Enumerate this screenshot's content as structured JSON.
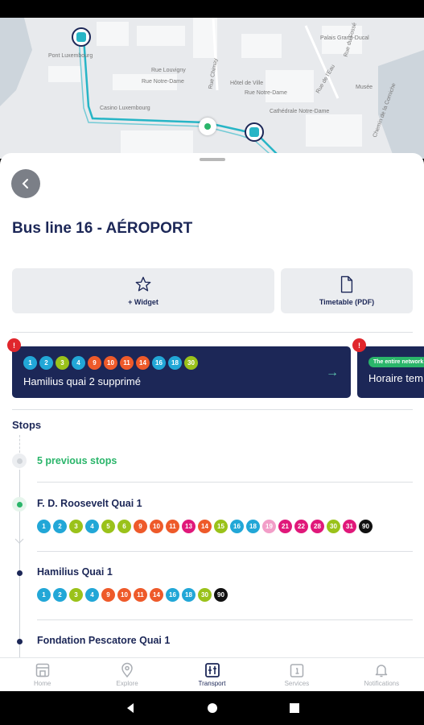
{
  "map": {
    "streets": [
      "Pont Luxembourg",
      "Rue Louvigny",
      "Rue Notre-Dame",
      "Casino Luxembourg",
      "Rue Chimay",
      "Hôtel de Ville",
      "Rue Notre-Dame",
      "Cathédrale Notre-Dame",
      "Palais Grand-Ducal",
      "Rue de l'Eau",
      "Musée",
      "Chemin de la Corniche",
      "Rue du Fossé"
    ]
  },
  "header": {
    "title": "Bus line 16 - AÉROPORT"
  },
  "actions": {
    "widget_label": "+ Widget",
    "timetable_label": "Timetable (PDF)"
  },
  "alerts": [
    {
      "badges": [
        {
          "n": "1",
          "c": "#22a7d7"
        },
        {
          "n": "2",
          "c": "#22a7d7"
        },
        {
          "n": "3",
          "c": "#9ac21a"
        },
        {
          "n": "4",
          "c": "#22a7d7"
        },
        {
          "n": "9",
          "c": "#ee5a2a"
        },
        {
          "n": "10",
          "c": "#ee5a2a"
        },
        {
          "n": "11",
          "c": "#ee5a2a"
        },
        {
          "n": "14",
          "c": "#ee5a2a"
        },
        {
          "n": "16",
          "c": "#22a7d7"
        },
        {
          "n": "18",
          "c": "#22a7d7"
        },
        {
          "n": "30",
          "c": "#9ac21a"
        }
      ],
      "text": "Hamilius quai 2 supprimé"
    },
    {
      "tag": "The entire network",
      "text": "Horaire tem"
    }
  ],
  "stops_title": "Stops",
  "previous_stops": "5 previous stops",
  "stops": [
    {
      "name": "F. D. Roosevelt Quai 1",
      "lines": [
        {
          "n": "1",
          "c": "#22a7d7"
        },
        {
          "n": "2",
          "c": "#22a7d7"
        },
        {
          "n": "3",
          "c": "#9ac21a"
        },
        {
          "n": "4",
          "c": "#22a7d7"
        },
        {
          "n": "5",
          "c": "#9ac21a"
        },
        {
          "n": "6",
          "c": "#9ac21a"
        },
        {
          "n": "9",
          "c": "#ee5a2a"
        },
        {
          "n": "10",
          "c": "#ee5a2a"
        },
        {
          "n": "11",
          "c": "#ee5a2a"
        },
        {
          "n": "13",
          "c": "#e0187a"
        },
        {
          "n": "14",
          "c": "#ee5a2a"
        },
        {
          "n": "15",
          "c": "#9ac21a"
        },
        {
          "n": "16",
          "c": "#22a7d7"
        },
        {
          "n": "18",
          "c": "#22a7d7"
        },
        {
          "n": "19",
          "c": "#f29ec8"
        },
        {
          "n": "21",
          "c": "#e0187a"
        },
        {
          "n": "22",
          "c": "#e0187a"
        },
        {
          "n": "28",
          "c": "#e0187a"
        },
        {
          "n": "30",
          "c": "#9ac21a"
        },
        {
          "n": "31",
          "c": "#e0187a"
        },
        {
          "n": "90",
          "c": "#111111"
        }
      ]
    },
    {
      "name": "Hamilius Quai 1",
      "lines": [
        {
          "n": "1",
          "c": "#22a7d7"
        },
        {
          "n": "2",
          "c": "#22a7d7"
        },
        {
          "n": "3",
          "c": "#9ac21a"
        },
        {
          "n": "4",
          "c": "#22a7d7"
        },
        {
          "n": "9",
          "c": "#ee5a2a"
        },
        {
          "n": "10",
          "c": "#ee5a2a"
        },
        {
          "n": "11",
          "c": "#ee5a2a"
        },
        {
          "n": "14",
          "c": "#ee5a2a"
        },
        {
          "n": "16",
          "c": "#22a7d7"
        },
        {
          "n": "18",
          "c": "#22a7d7"
        },
        {
          "n": "30",
          "c": "#9ac21a"
        },
        {
          "n": "90",
          "c": "#111111"
        }
      ]
    },
    {
      "name": "Fondation Pescatore Quai 1",
      "lines": []
    }
  ],
  "nav": {
    "items": [
      {
        "label": "Home",
        "icon": "home-icon"
      },
      {
        "label": "Explore",
        "icon": "map-pin-icon"
      },
      {
        "label": "Transport",
        "icon": "transport-icon"
      },
      {
        "label": "Services",
        "icon": "services-icon"
      },
      {
        "label": "Notifications",
        "icon": "bell-icon"
      }
    ],
    "active": "Transport"
  },
  "colors": {
    "navy": "#1c2757",
    "green": "#2ab56a",
    "alert_red": "#e0262c",
    "route_teal": "#27b5c6"
  }
}
